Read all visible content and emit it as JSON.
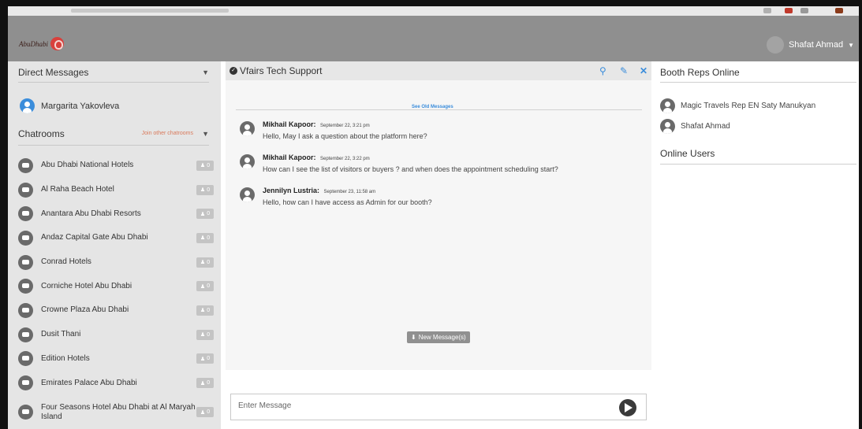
{
  "header": {
    "user_name": "Shafat Ahmad",
    "logo_text": "AbuDhabi"
  },
  "direct_messages": {
    "title": "Direct Messages",
    "contacts": [
      {
        "name": "Margarita Yakovleva"
      }
    ]
  },
  "chatrooms": {
    "title": "Chatrooms",
    "join_label": "Join other chatrooms",
    "rooms": [
      {
        "name": "Abu Dhabi National Hotels",
        "count": "0"
      },
      {
        "name": "Al Raha Beach Hotel",
        "count": "0"
      },
      {
        "name": "Anantara Abu Dhabi Resorts",
        "count": "0"
      },
      {
        "name": "Andaz Capital Gate Abu Dhabi",
        "count": "0"
      },
      {
        "name": "Conrad Hotels",
        "count": "0"
      },
      {
        "name": "Corniche Hotel Abu Dhabi",
        "count": "0"
      },
      {
        "name": "Crowne Plaza Abu Dhabi",
        "count": "0"
      },
      {
        "name": "Dusit Thani",
        "count": "0"
      },
      {
        "name": "Edition Hotels",
        "count": "0"
      },
      {
        "name": "Emirates Palace Abu Dhabi",
        "count": "0"
      },
      {
        "name": "Four Seasons Hotel Abu Dhabi at Al Maryah Island",
        "count": "0"
      }
    ]
  },
  "chat": {
    "title": "Vfairs Tech Support",
    "see_old": "See Old Messages",
    "messages": [
      {
        "author": "Mikhail Kapoor:",
        "time": "September 22, 3:21 pm",
        "text": "Hello, May I ask a question about the platform here?"
      },
      {
        "author": "Mikhail Kapoor:",
        "time": "September 22, 3:22 pm",
        "text": "How can I see the list of visitors or buyers ? and when does the appointment scheduling start?"
      },
      {
        "author": "Jennilyn Lustria:",
        "time": "September 23, 11:58 am",
        "text": "Hello, how can I have access as Admin for our booth?"
      }
    ],
    "new_messages": "New Message(s)",
    "input_placeholder": "Enter Message"
  },
  "booth": {
    "title": "Booth Reps Online",
    "reps": [
      {
        "name": "Magic Travels Rep EN Saty Manukyan"
      },
      {
        "name": "Shafat Ahmad"
      }
    ],
    "online_users_title": "Online Users"
  },
  "colors": {
    "accent": "#3b8ddb",
    "nav": "#8f8f8f",
    "sidebar": "#e5e5e5"
  }
}
